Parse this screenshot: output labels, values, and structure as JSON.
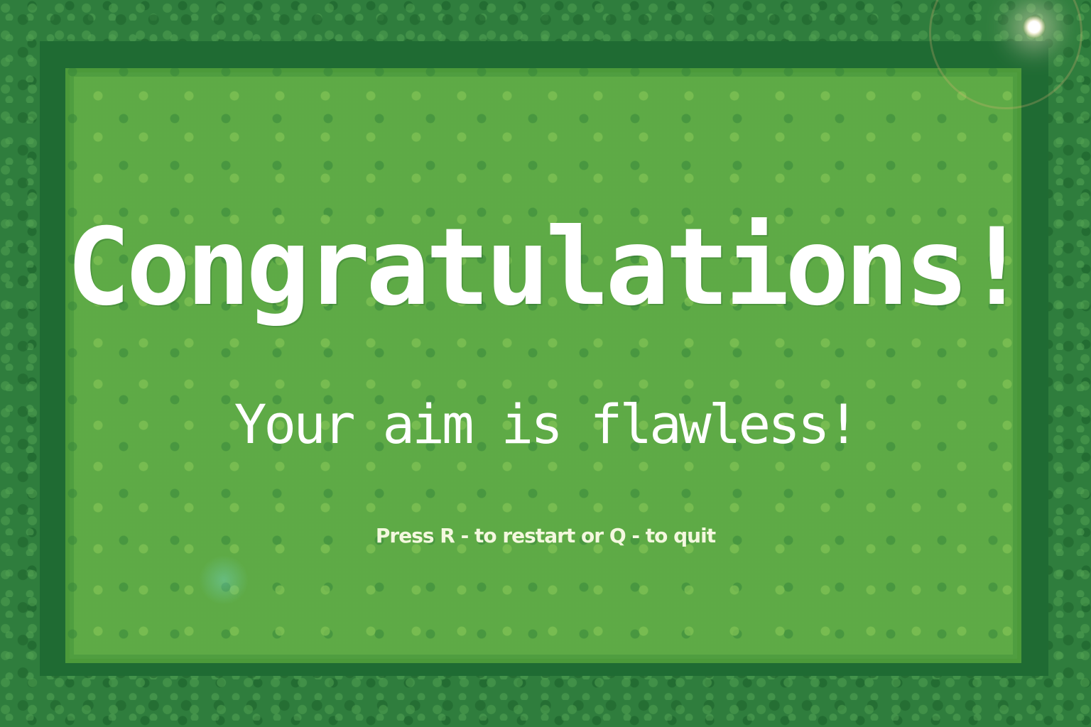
{
  "screen": {
    "title": "Congratulations!",
    "subtitle": "Your aim is flawless!",
    "hint": "Press R - to restart or Q - to quit"
  },
  "colors": {
    "border_green": "#2f7d3d",
    "panel_green": "#58a83f",
    "text": "#ffffff"
  }
}
